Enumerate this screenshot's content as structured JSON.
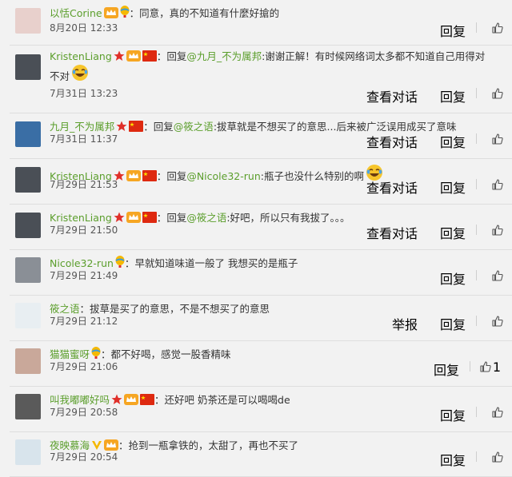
{
  "comments": [
    {
      "user": "以恬Corine",
      "badges": [
        "crown",
        "balloon"
      ],
      "sep": "：",
      "reply_label": "",
      "reply_to": "",
      "text": "同意，真的不知道有什麼好搶的",
      "time": "8月20日 12:33",
      "actions": [
        "回复"
      ],
      "likes": "",
      "avatar_color": "#e8d0cc"
    },
    {
      "user": "KristenLiang",
      "badges": [
        "star",
        "crown",
        "flag"
      ],
      "sep": "：",
      "reply_label": "回复",
      "reply_to": "@九月_不为属邦",
      "text": ":谢谢正解！有时候网络词太多都不知道自己用得对不对",
      "emoji": "laugh",
      "time": "7月31日 13:23",
      "actions": [
        "查看对话",
        "回复"
      ],
      "likes": "",
      "avatar_color": "#4a4f56"
    },
    {
      "user": "九月_不为属邦",
      "badges": [
        "star",
        "flag"
      ],
      "sep": "：",
      "reply_label": "回复",
      "reply_to": "@筱之语",
      "text": ":拔草就是不想买了的意思...后来被广泛误用成买了意味",
      "time": "7月31日 11:37",
      "actions": [
        "查看对话",
        "回复"
      ],
      "likes": "",
      "avatar_color": "#3a6ea5"
    },
    {
      "user": "KristenLiang",
      "badges": [
        "star",
        "crown",
        "flag"
      ],
      "sep": "：",
      "reply_label": "回复",
      "reply_to": "@Nicole32-run",
      "text": ":瓶子也没什么特别的啊",
      "emoji": "laugh",
      "time": "7月29日 21:53",
      "actions": [
        "查看对话",
        "回复"
      ],
      "likes": "",
      "avatar_color": "#4a4f56"
    },
    {
      "user": "KristenLiang",
      "badges": [
        "star",
        "crown",
        "flag"
      ],
      "sep": "：",
      "reply_label": "回复",
      "reply_to": "@筱之语",
      "text": ":好吧，所以只有我拔了。。。",
      "time": "7月29日 21:50",
      "actions": [
        "查看对话",
        "回复"
      ],
      "likes": "",
      "avatar_color": "#4a4f56"
    },
    {
      "user": "Nicole32-run",
      "badges": [
        "balloon"
      ],
      "sep": "：",
      "reply_label": "",
      "reply_to": "",
      "text": "早就知道味道一般了 我想买的是瓶子",
      "time": "7月29日 21:49",
      "actions": [
        "回复"
      ],
      "likes": "",
      "avatar_color": "#8a8f96"
    },
    {
      "user": "筱之语",
      "badges": [],
      "sep": "：",
      "reply_label": "",
      "reply_to": "",
      "text": "拔草是买了的意思，不是不想买了的意思",
      "time": "7月29日 21:12",
      "actions": [
        "举报",
        "回复"
      ],
      "likes": "",
      "avatar_color": "#e8eef2"
    },
    {
      "user": "猫猫蜜呀",
      "badges": [
        "balloon"
      ],
      "sep": "：",
      "reply_label": "",
      "reply_to": "",
      "text": "都不好喝，感觉一股香精味",
      "time": "7月29日 21:06",
      "actions": [
        "回复"
      ],
      "likes": "1",
      "avatar_color": "#c9a89a"
    },
    {
      "user": "叫我嘟嘟好吗",
      "badges": [
        "star",
        "crown",
        "flag"
      ],
      "sep": "：",
      "reply_label": "",
      "reply_to": "",
      "text": "还好吧 奶茶还是可以喝喝de",
      "time": "7月29日 20:58",
      "actions": [
        "回复"
      ],
      "likes": "",
      "avatar_color": "#5a5a5a"
    },
    {
      "user": "夜映慕海",
      "badges": [
        "vip",
        "crown"
      ],
      "sep": "：",
      "reply_label": "",
      "reply_to": "",
      "text": "抢到一瓶拿铁的，太甜了，再也不买了",
      "time": "7月29日 20:54",
      "actions": [
        "回复"
      ],
      "likes": "",
      "avatar_color": "#d8e4ec"
    }
  ]
}
